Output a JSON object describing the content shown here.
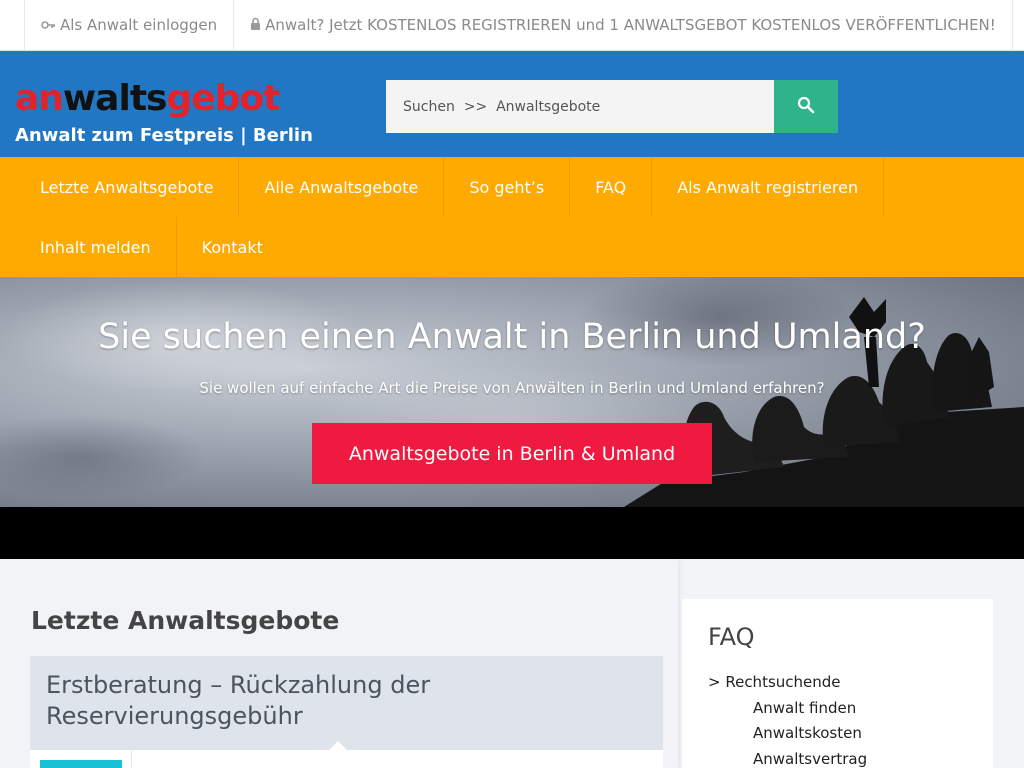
{
  "topbar": {
    "login_label": "Als Anwalt einloggen",
    "register_label": "Anwalt? Jetzt KOSTENLOS REGISTRIEREN und 1 ANWALTSGEBOT KOSTENLOS VERÖFFENTLICHEN!"
  },
  "header": {
    "logo_part1": "an",
    "logo_part2": "walts",
    "logo_part3": "gebot",
    "tagline": "Anwalt zum Festpreis | Berlin",
    "search_placeholder": "Suchen  >>  Anwaltsgebote"
  },
  "nav": {
    "items": [
      "Letzte Anwaltsgebote",
      "Alle Anwaltsgebote",
      "So geht’s",
      "FAQ",
      "Als Anwalt registrieren",
      "Inhalt melden",
      "Kontakt"
    ]
  },
  "hero": {
    "title": "Sie suchen einen Anwalt in Berlin und Umland?",
    "subtitle": "Sie wollen auf einfache Art die Preise von Anwälten in Berlin und Umland erfahren?",
    "cta_label": "Anwaltsgebote in Berlin & Umland"
  },
  "main": {
    "section_title": "Letzte Anwaltsgebote",
    "post_title": "Erstberatung – Rückzahlung der Reservierungsgebühr"
  },
  "sidebar": {
    "title": "FAQ",
    "category": "> Rechtsuchende",
    "links": [
      "Anwalt finden",
      "Anwaltskosten",
      "Anwaltsvertrag"
    ]
  },
  "colors": {
    "header_blue": "#2277c4",
    "nav_orange": "#ffaa00",
    "search_green": "#2fb38b",
    "cta_red": "#f0193f",
    "logo_red": "#e3232c",
    "badge_cyan": "#18c1d4"
  },
  "icons": {
    "login": "key-icon",
    "register": "lock-icon",
    "search": "search-icon"
  }
}
